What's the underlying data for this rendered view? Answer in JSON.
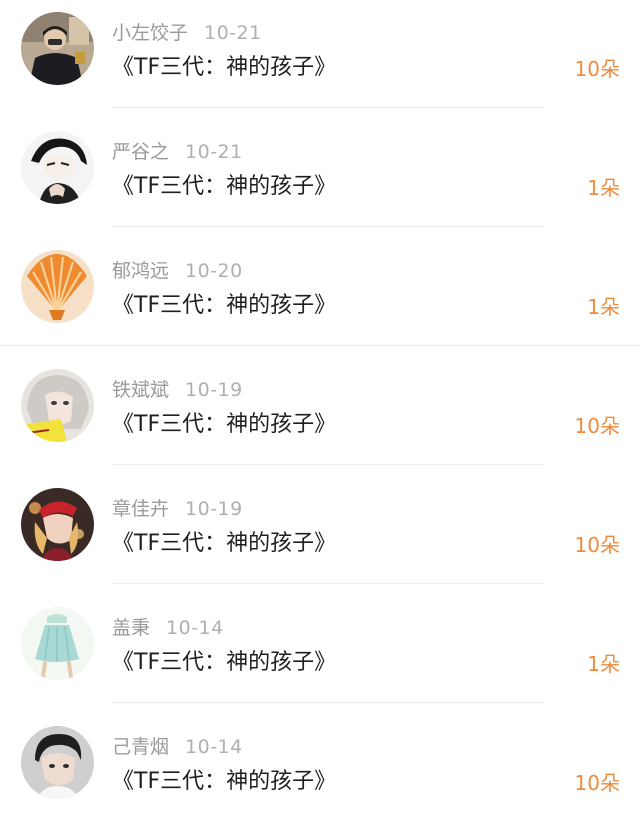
{
  "colors": {
    "name": "#9a9a9a",
    "date": "#b0b0b0",
    "title": "#1f1f1f",
    "count": "#f08a3c",
    "divider": "#ececec"
  },
  "rows": [
    {
      "name": "小左饺子",
      "date": "10-21",
      "title": "《TF三代：神的孩子》",
      "count": "10朵",
      "avatar": "avatar-photo-person-dark-jacket"
    },
    {
      "name": "严谷之",
      "date": "10-21",
      "title": "《TF三代：神的孩子》",
      "count": "1朵",
      "avatar": "avatar-anime-boy-monochrome"
    },
    {
      "name": "郁鸿远",
      "date": "10-20",
      "title": "《TF三代：神的孩子》",
      "count": "1朵",
      "avatar": "avatar-orange-seashell"
    },
    {
      "name": "铁斌斌",
      "date": "10-19",
      "title": "《TF三代：神的孩子》",
      "count": "10朵",
      "avatar": "avatar-girl-pale-hair"
    },
    {
      "name": "章佳卉",
      "date": "10-19",
      "title": "《TF三代：神的孩子》",
      "count": "10朵",
      "avatar": "avatar-girl-red-hat"
    },
    {
      "name": "盖秉",
      "date": "10-14",
      "title": "《TF三代：神的孩子》",
      "count": "1朵",
      "avatar": "avatar-mint-skirt-illustration"
    },
    {
      "name": "己青烟",
      "date": "10-14",
      "title": "《TF三代：神的孩子》",
      "count": "10朵",
      "avatar": "avatar-boy-portrait"
    }
  ]
}
